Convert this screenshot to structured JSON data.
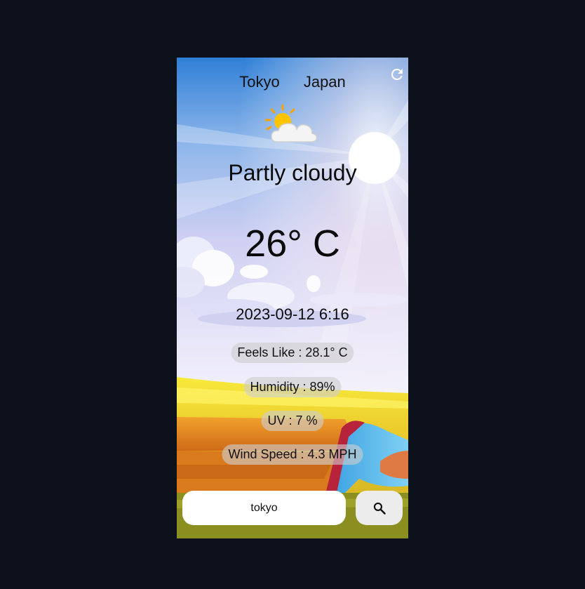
{
  "location": {
    "city": "Tokyo",
    "country": "Japan"
  },
  "weather": {
    "condition": "Partly cloudy",
    "temperature": "26° C",
    "datetime": "2023-09-12 6:16",
    "icon": "partly-cloudy-icon"
  },
  "details": {
    "feels_like": "Feels Like : 28.1° C",
    "humidity": "Humidity : 89%",
    "uv": "UV : 7 %",
    "wind_speed": "Wind Speed : 4.3 MPH"
  },
  "search": {
    "value": "tokyo",
    "button_icon": "search-icon"
  },
  "refresh_icon": "refresh-icon",
  "colors": {
    "page_background": "#0c111b",
    "sky_top": "#2f7fd6",
    "sky_mid": "#cfd0f2",
    "field": "#f2d430",
    "pill_background": "#cdcdcd"
  }
}
